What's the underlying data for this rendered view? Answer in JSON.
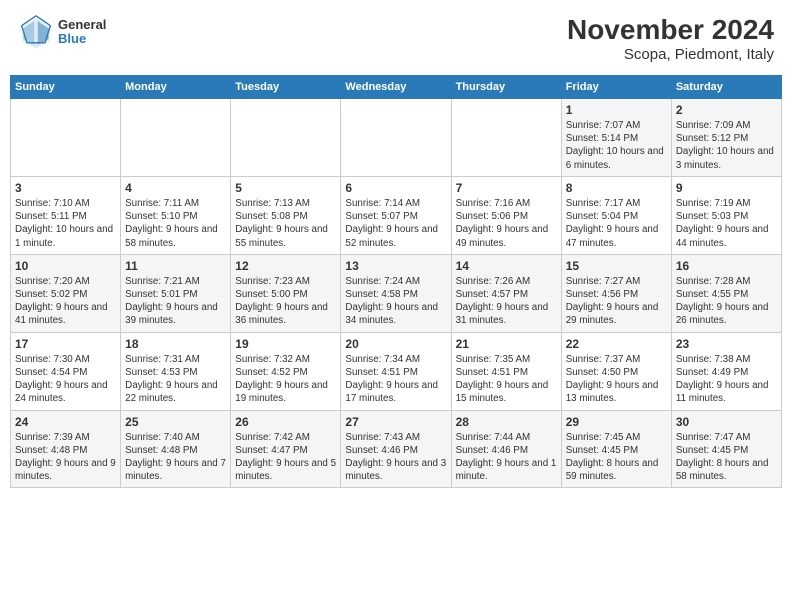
{
  "header": {
    "logo_general": "General",
    "logo_blue": "Blue",
    "title": "November 2024",
    "subtitle": "Scopa, Piedmont, Italy"
  },
  "days_of_week": [
    "Sunday",
    "Monday",
    "Tuesday",
    "Wednesday",
    "Thursday",
    "Friday",
    "Saturday"
  ],
  "weeks": [
    [
      {
        "day": "",
        "info": ""
      },
      {
        "day": "",
        "info": ""
      },
      {
        "day": "",
        "info": ""
      },
      {
        "day": "",
        "info": ""
      },
      {
        "day": "",
        "info": ""
      },
      {
        "day": "1",
        "info": "Sunrise: 7:07 AM\nSunset: 5:14 PM\nDaylight: 10 hours and 6 minutes."
      },
      {
        "day": "2",
        "info": "Sunrise: 7:09 AM\nSunset: 5:12 PM\nDaylight: 10 hours and 3 minutes."
      }
    ],
    [
      {
        "day": "3",
        "info": "Sunrise: 7:10 AM\nSunset: 5:11 PM\nDaylight: 10 hours and 1 minute."
      },
      {
        "day": "4",
        "info": "Sunrise: 7:11 AM\nSunset: 5:10 PM\nDaylight: 9 hours and 58 minutes."
      },
      {
        "day": "5",
        "info": "Sunrise: 7:13 AM\nSunset: 5:08 PM\nDaylight: 9 hours and 55 minutes."
      },
      {
        "day": "6",
        "info": "Sunrise: 7:14 AM\nSunset: 5:07 PM\nDaylight: 9 hours and 52 minutes."
      },
      {
        "day": "7",
        "info": "Sunrise: 7:16 AM\nSunset: 5:06 PM\nDaylight: 9 hours and 49 minutes."
      },
      {
        "day": "8",
        "info": "Sunrise: 7:17 AM\nSunset: 5:04 PM\nDaylight: 9 hours and 47 minutes."
      },
      {
        "day": "9",
        "info": "Sunrise: 7:19 AM\nSunset: 5:03 PM\nDaylight: 9 hours and 44 minutes."
      }
    ],
    [
      {
        "day": "10",
        "info": "Sunrise: 7:20 AM\nSunset: 5:02 PM\nDaylight: 9 hours and 41 minutes."
      },
      {
        "day": "11",
        "info": "Sunrise: 7:21 AM\nSunset: 5:01 PM\nDaylight: 9 hours and 39 minutes."
      },
      {
        "day": "12",
        "info": "Sunrise: 7:23 AM\nSunset: 5:00 PM\nDaylight: 9 hours and 36 minutes."
      },
      {
        "day": "13",
        "info": "Sunrise: 7:24 AM\nSunset: 4:58 PM\nDaylight: 9 hours and 34 minutes."
      },
      {
        "day": "14",
        "info": "Sunrise: 7:26 AM\nSunset: 4:57 PM\nDaylight: 9 hours and 31 minutes."
      },
      {
        "day": "15",
        "info": "Sunrise: 7:27 AM\nSunset: 4:56 PM\nDaylight: 9 hours and 29 minutes."
      },
      {
        "day": "16",
        "info": "Sunrise: 7:28 AM\nSunset: 4:55 PM\nDaylight: 9 hours and 26 minutes."
      }
    ],
    [
      {
        "day": "17",
        "info": "Sunrise: 7:30 AM\nSunset: 4:54 PM\nDaylight: 9 hours and 24 minutes."
      },
      {
        "day": "18",
        "info": "Sunrise: 7:31 AM\nSunset: 4:53 PM\nDaylight: 9 hours and 22 minutes."
      },
      {
        "day": "19",
        "info": "Sunrise: 7:32 AM\nSunset: 4:52 PM\nDaylight: 9 hours and 19 minutes."
      },
      {
        "day": "20",
        "info": "Sunrise: 7:34 AM\nSunset: 4:51 PM\nDaylight: 9 hours and 17 minutes."
      },
      {
        "day": "21",
        "info": "Sunrise: 7:35 AM\nSunset: 4:51 PM\nDaylight: 9 hours and 15 minutes."
      },
      {
        "day": "22",
        "info": "Sunrise: 7:37 AM\nSunset: 4:50 PM\nDaylight: 9 hours and 13 minutes."
      },
      {
        "day": "23",
        "info": "Sunrise: 7:38 AM\nSunset: 4:49 PM\nDaylight: 9 hours and 11 minutes."
      }
    ],
    [
      {
        "day": "24",
        "info": "Sunrise: 7:39 AM\nSunset: 4:48 PM\nDaylight: 9 hours and 9 minutes."
      },
      {
        "day": "25",
        "info": "Sunrise: 7:40 AM\nSunset: 4:48 PM\nDaylight: 9 hours and 7 minutes."
      },
      {
        "day": "26",
        "info": "Sunrise: 7:42 AM\nSunset: 4:47 PM\nDaylight: 9 hours and 5 minutes."
      },
      {
        "day": "27",
        "info": "Sunrise: 7:43 AM\nSunset: 4:46 PM\nDaylight: 9 hours and 3 minutes."
      },
      {
        "day": "28",
        "info": "Sunrise: 7:44 AM\nSunset: 4:46 PM\nDaylight: 9 hours and 1 minute."
      },
      {
        "day": "29",
        "info": "Sunrise: 7:45 AM\nSunset: 4:45 PM\nDaylight: 8 hours and 59 minutes."
      },
      {
        "day": "30",
        "info": "Sunrise: 7:47 AM\nSunset: 4:45 PM\nDaylight: 8 hours and 58 minutes."
      }
    ]
  ]
}
